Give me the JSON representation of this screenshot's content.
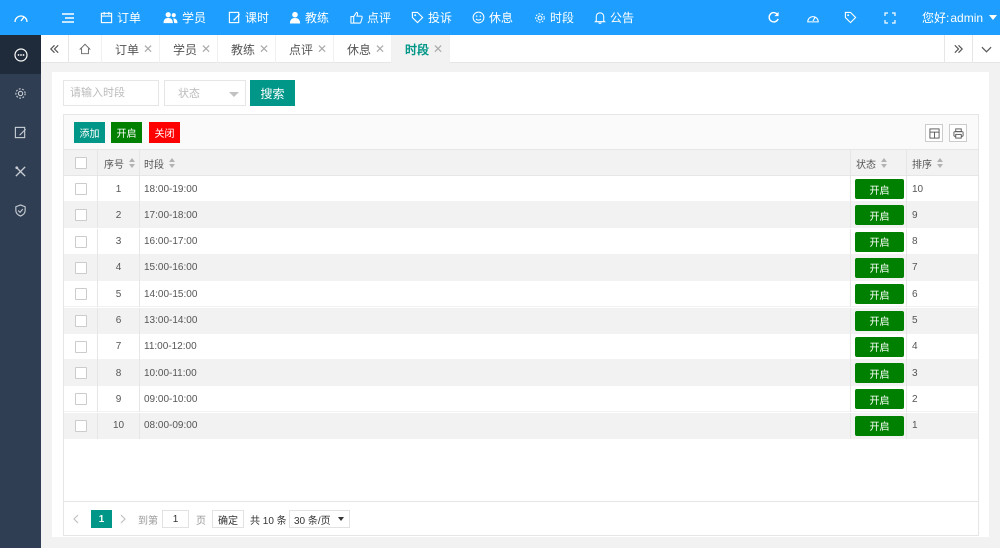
{
  "header": {
    "nav": [
      {
        "icon": "calendar-icon",
        "label": "订单"
      },
      {
        "icon": "users-icon",
        "label": "学员"
      },
      {
        "icon": "edit-icon",
        "label": "课时"
      },
      {
        "icon": "user-icon",
        "label": "教练"
      },
      {
        "icon": "thumbs-up-icon",
        "label": "点评"
      },
      {
        "icon": "tag-icon",
        "label": "投诉"
      },
      {
        "icon": "smile-icon",
        "label": "休息"
      },
      {
        "icon": "gear-icon",
        "label": "时段"
      },
      {
        "icon": "bell-icon",
        "label": "公告"
      }
    ],
    "greeting": "您好:",
    "username": "admin"
  },
  "tabs": [
    "订单",
    "学员",
    "教练",
    "点评",
    "休息",
    "时段"
  ],
  "active_tab": "时段",
  "search": {
    "placeholder": "请输入时段",
    "status_placeholder": "状态",
    "button": "搜索"
  },
  "toolbar": {
    "add": "添加",
    "enable": "开启",
    "disable": "关闭",
    "colors": {
      "add": "#009688",
      "enable": "#008000",
      "disable": "#ff0000"
    }
  },
  "table": {
    "headers": {
      "index": "序号",
      "slot": "时段",
      "status": "状态",
      "order": "排序"
    },
    "rows": [
      {
        "index": "1",
        "slot": "18:00-19:00",
        "status": "开启",
        "order": "10"
      },
      {
        "index": "2",
        "slot": "17:00-18:00",
        "status": "开启",
        "order": "9"
      },
      {
        "index": "3",
        "slot": "16:00-17:00",
        "status": "开启",
        "order": "8"
      },
      {
        "index": "4",
        "slot": "15:00-16:00",
        "status": "开启",
        "order": "7"
      },
      {
        "index": "5",
        "slot": "14:00-15:00",
        "status": "开启",
        "order": "6"
      },
      {
        "index": "6",
        "slot": "13:00-14:00",
        "status": "开启",
        "order": "5"
      },
      {
        "index": "7",
        "slot": "11:00-12:00",
        "status": "开启",
        "order": "4"
      },
      {
        "index": "8",
        "slot": "10:00-11:00",
        "status": "开启",
        "order": "3"
      },
      {
        "index": "9",
        "slot": "09:00-10:00",
        "status": "开启",
        "order": "2"
      },
      {
        "index": "10",
        "slot": "08:00-09:00",
        "status": "开启",
        "order": "1"
      }
    ]
  },
  "pager": {
    "current": "1",
    "goto_label": "到第",
    "goto_value": "1",
    "page_unit": "页",
    "confirm": "确定",
    "total": "共 10 条",
    "page_size": "30 条/页"
  },
  "colors": {
    "primary": "#1e9fff",
    "sidebar": "#2f3e52",
    "teal": "#009688",
    "green": "#008000"
  }
}
